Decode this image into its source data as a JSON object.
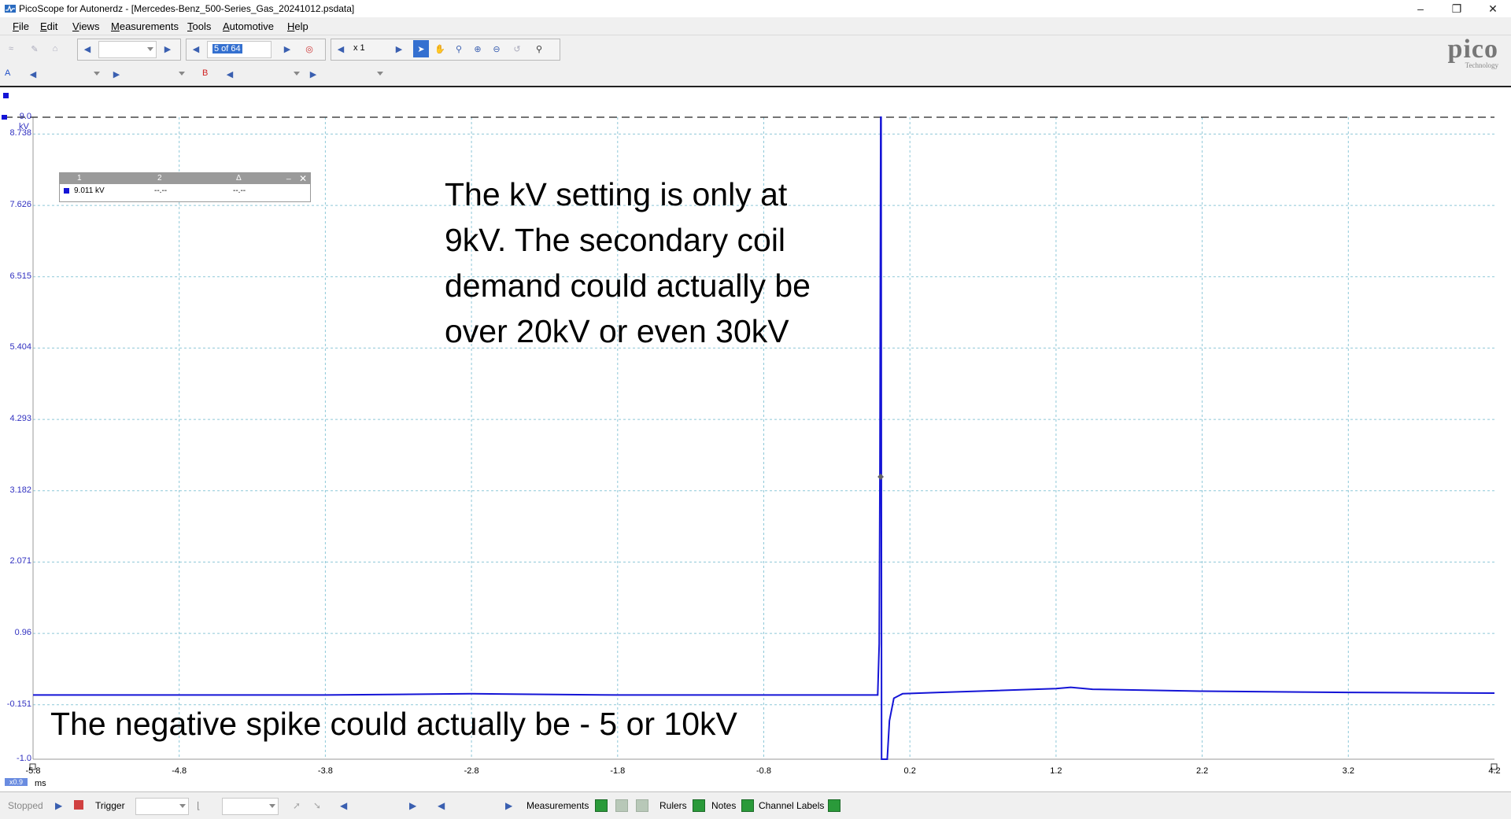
{
  "window": {
    "title": "PicoScope for Autonerdz - [Mercedes-Benz_500-Series_Gas_20241012.psdata]"
  },
  "menu": [
    "File",
    "Edit",
    "Views",
    "Measurements",
    "Tools",
    "Automotive",
    "Help"
  ],
  "toolbar": {
    "buffer_position": "5 of 64",
    "zoom_factor": "x 1",
    "channel_a_label": "A",
    "channel_b_label": "B"
  },
  "logo": {
    "name": "pico",
    "sub": "Technology"
  },
  "scope": {
    "y_unit": "kV",
    "y_ticks": [
      "9.0",
      "8.738",
      "7.626",
      "6.515",
      "5.404",
      "4.293",
      "3.182",
      "2.071",
      "0.96",
      "-0.151",
      "-1.0"
    ],
    "x_unit": "ms",
    "x_ticks": [
      "-5.8",
      "-4.8",
      "-3.8",
      "-2.8",
      "-1.8",
      "-0.8",
      "0.2",
      "1.2",
      "2.2",
      "3.2",
      "4.2"
    ],
    "zoom_badge": "x0.9",
    "trace_color": "#1414d6"
  },
  "rulers": {
    "headers": [
      "1",
      "2",
      "Δ"
    ],
    "values": [
      "9.011 kV",
      "--.--",
      "--.--"
    ]
  },
  "annotations": {
    "kv_note": [
      "The kV setting is only at",
      "9kV. The secondary coil",
      "demand could actually be",
      "over 20kV or even 30kV"
    ],
    "spike_note": "The negative spike could actually be - 5 or 10kV"
  },
  "statusbar": {
    "state": "Stopped",
    "trigger": "Trigger",
    "measurements": "Measurements",
    "rulers": "Rulers",
    "notes": "Notes",
    "channel_labels": "Channel Labels"
  }
}
